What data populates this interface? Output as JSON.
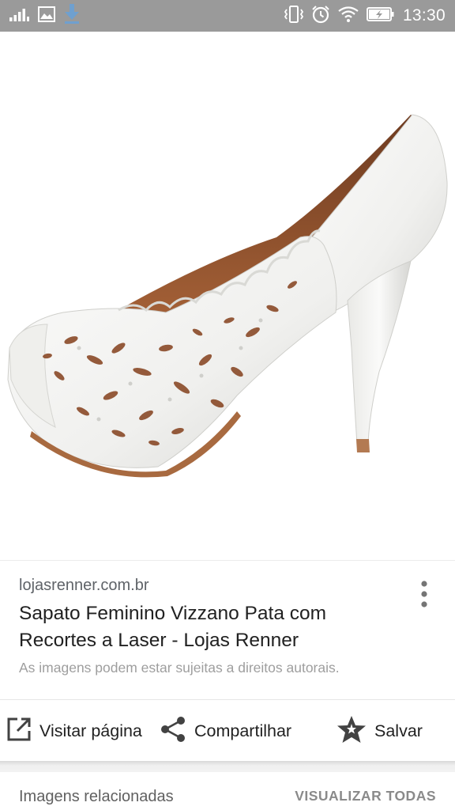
{
  "status_bar": {
    "time": "13:30",
    "icons": [
      "signal-icon",
      "image-notification-icon",
      "download-icon",
      "vibrate-icon",
      "alarm-icon",
      "wifi-icon",
      "battery-charging-icon"
    ]
  },
  "image": {
    "subject": "white-laser-cut-pump-shoe"
  },
  "result": {
    "source": "lojasrenner.com.br",
    "title": "Sapato Feminino Vizzano Pata com Recortes a Laser - Lojas Renner",
    "copyright_note": "As imagens podem estar sujeitas a direitos autorais.",
    "more_icon": "more-vert-icon"
  },
  "actions": {
    "visit_label": "Visitar página",
    "share_label": "Compartilhar",
    "save_label": "Salvar"
  },
  "related": {
    "title": "Imagens relacionadas",
    "view_all_label": "VISUALIZAR TODAS"
  },
  "colors": {
    "status_bar": "#9a9a9a",
    "shoe_white": "#f4f4f2",
    "shoe_lining": "#8a4a28",
    "text_primary": "#212121",
    "text_secondary": "#5f6368"
  }
}
